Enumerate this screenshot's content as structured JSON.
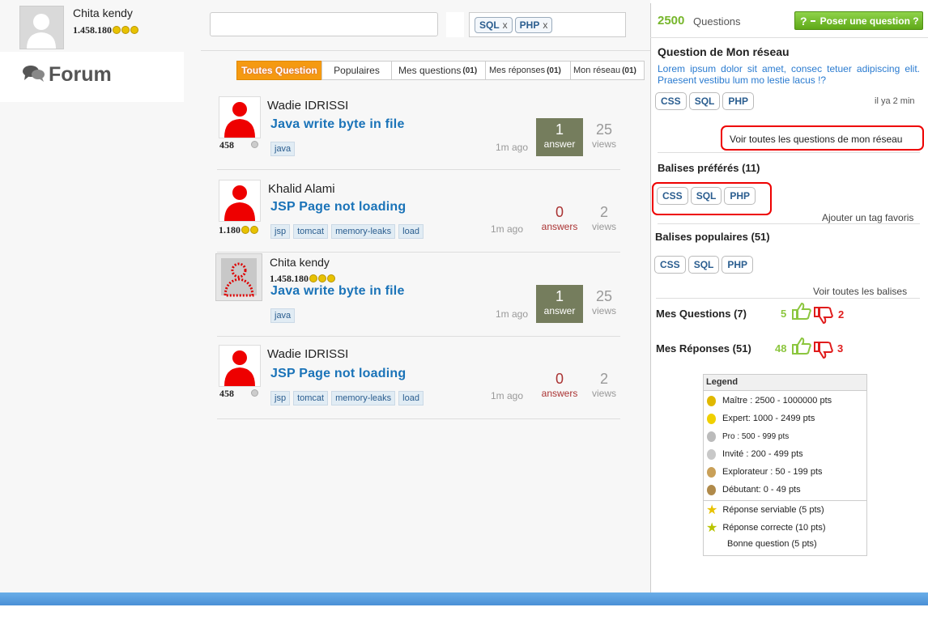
{
  "header": {
    "user_name": "Chita kendy",
    "user_reputation": "1.458.180",
    "search_placeholder": "",
    "tag_filter": [
      {
        "label": "SQL",
        "remove": "x"
      },
      {
        "label": "PHP",
        "remove": "x"
      }
    ]
  },
  "forum": {
    "title": "Forum",
    "icon": "comments-icon"
  },
  "tabs": [
    {
      "label": "Toutes Question",
      "count": "",
      "active": true
    },
    {
      "label": "Populaires",
      "count": ""
    },
    {
      "label": "Mes questions",
      "count": "(01)"
    },
    {
      "label": "Mes réponses",
      "count": "(01)"
    },
    {
      "label": "Mon réseau",
      "count": "(01)"
    }
  ],
  "questions": [
    {
      "author": "Wadie IDRISSI",
      "reputation": "458",
      "title": "Java write byte in file",
      "tags": [
        "java"
      ],
      "ago": "1m ago",
      "answers": "1",
      "answers_label": "answer",
      "views": "25",
      "views_label": "views"
    },
    {
      "author": "Khalid Alami",
      "reputation": "1.180",
      "title": "JSP Page not loading",
      "tags": [
        "jsp",
        "tomcat",
        "memory-leaks",
        "load"
      ],
      "ago": "1m ago",
      "answers": "0",
      "answers_label": "answers",
      "views": "2",
      "views_label": "views"
    },
    {
      "author": "Chita kendy",
      "reputation": "1.458.180",
      "title": "Java write byte in file",
      "tags": [
        "java"
      ],
      "ago": "1m ago",
      "answers": "1",
      "answers_label": "answer",
      "views": "25",
      "views_label": "views"
    },
    {
      "author": "Wadie IDRISSI",
      "reputation": "458",
      "title": "JSP Page not loading",
      "tags": [
        "jsp",
        "tomcat",
        "memory-leaks",
        "load"
      ],
      "ago": "1m ago",
      "answers": "0",
      "answers_label": "answers",
      "views": "2",
      "views_label": "views"
    }
  ],
  "sidebar": {
    "count": "2500",
    "count_label": "Questions",
    "ask_label": "Poser une question ?",
    "network": {
      "title": "Question de Mon réseau",
      "text": "Lorem ipsum dolor sit amet, consec tetuer adipiscing elit. Praesent vestibu lum mo lestie lacus !?",
      "tags": [
        "CSS",
        "SQL",
        "PHP"
      ],
      "ago": "il ya 2 min",
      "see_all": "Voir toutes les questions de mon réseau"
    },
    "favorites": {
      "title": "Balises préférés (11)",
      "tags": [
        "CSS",
        "SQL",
        "PHP"
      ],
      "add": "Ajouter un tag favoris"
    },
    "popular": {
      "title": "Balises populaires (51)",
      "tags": [
        "CSS",
        "SQL",
        "PHP"
      ],
      "see_all": "Voir toutes les balises"
    },
    "my_questions": {
      "label": "Mes Questions",
      "count": "(7)",
      "up": "5",
      "down": "2"
    },
    "my_answers": {
      "label": "Mes Réponses",
      "count": "(51)",
      "up": "48",
      "down": "3"
    },
    "legend": {
      "title": "Legend",
      "ranks": [
        {
          "label": "Maître : 2500 - 1000000 pts",
          "color": "#e0b800"
        },
        {
          "label": "Expert: 1000 - 2499 pts",
          "color": "#f0d000"
        },
        {
          "label": "Pro : 500 - 999 pts",
          "color": "#bbbbbb"
        },
        {
          "label": "Invité : 200 - 499 pts",
          "color": "#c8c8c8"
        },
        {
          "label": "Explorateur : 50 - 199 pts",
          "color": "#c9a058"
        },
        {
          "label": "Débutant: 0 - 49 pts",
          "color": "#b08a4a"
        }
      ],
      "points": [
        {
          "label": "Réponse serviable (5 pts)",
          "icon": "star-icon"
        },
        {
          "label": "Réponse correcte (10 pts)",
          "icon": "star-check-icon"
        },
        {
          "label": "Bonne question (5 pts)",
          "icon": ""
        }
      ]
    }
  }
}
